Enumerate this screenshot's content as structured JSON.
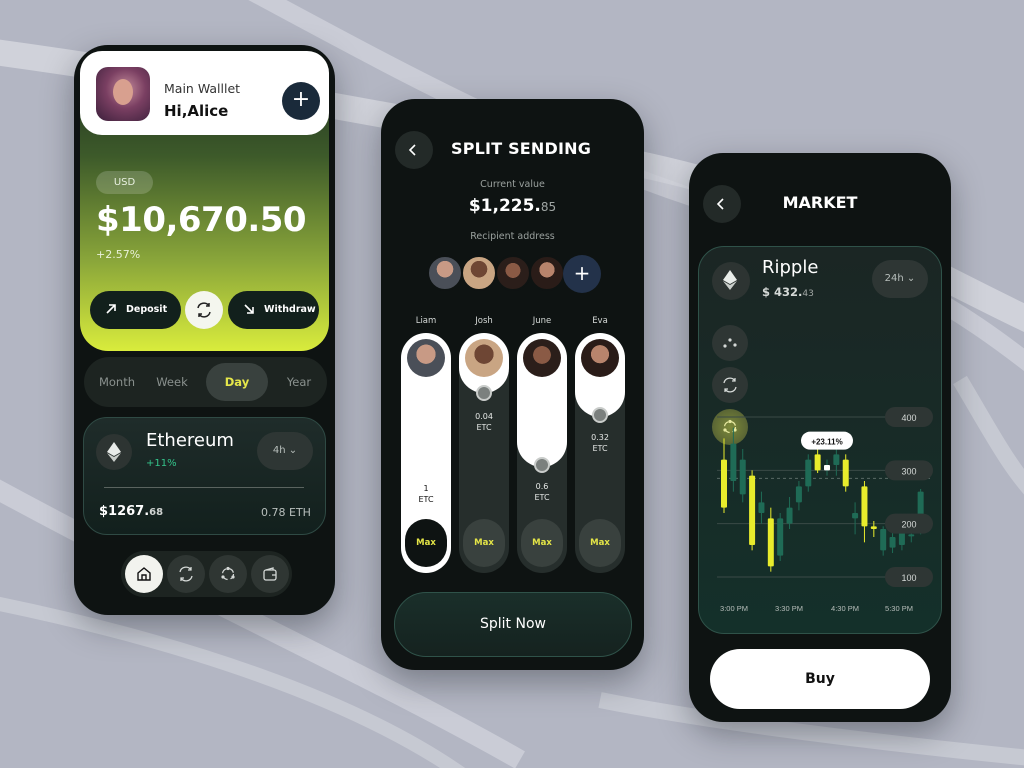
{
  "colors": {
    "background": "#b3b6c3",
    "phone": "#0e1312",
    "accent_yellow": "#e4e547",
    "positive_green": "#34c38a",
    "candle_up": "#e8ec2c",
    "candle_down": "#1f6b56"
  },
  "wallet": {
    "subtitle": "Main Walllet",
    "greeting": "Hi,Alice",
    "add_icon": "+",
    "currency": "USD",
    "balance": "$10,670.50",
    "change": "+2.57%",
    "deposit_label": "Deposit",
    "withdraw_label": "Withdraw",
    "periods": [
      "Month",
      "Week",
      "Day",
      "Year"
    ],
    "active_period": "Day",
    "asset": {
      "name": "Ethereum",
      "change": "+11%",
      "interval": "4h",
      "price_main": "$1267.",
      "price_cents": "68",
      "amount": "0.78 ETH"
    },
    "nav": [
      "home-icon",
      "swap-icon",
      "network-icon",
      "wallet-icon"
    ]
  },
  "split": {
    "title": "SPLIT SENDING",
    "current_label": "Current value",
    "current_main": "$1,225.",
    "current_cents": "85",
    "recipient_label": "Recipient address",
    "add_icon": "+",
    "recipients": [
      {
        "name": "Liam",
        "amount": 1,
        "unit": "ETC",
        "fill": 1.0
      },
      {
        "name": "Josh",
        "amount": 0.04,
        "unit": "ETC",
        "fill": 0.26
      },
      {
        "name": "June",
        "amount": 0.6,
        "unit": "ETC",
        "fill": 0.56
      },
      {
        "name": "Eva",
        "amount": 0.32,
        "unit": "ETC",
        "fill": 0.35
      }
    ],
    "max_label": "Max",
    "button_label": "Split Now"
  },
  "market": {
    "title": "MARKET",
    "coin": "Ripple",
    "price_main": "$ 432.",
    "price_cents": "43",
    "interval": "24h",
    "badge": "+23.11%",
    "buy_label": "Buy"
  },
  "chart_data": {
    "type": "candlestick",
    "x_tick_labels": [
      "3:00 PM",
      "3:30 PM",
      "4:30 PM",
      "5:30 PM"
    ],
    "y_tick_labels": [
      "400",
      "300",
      "200",
      "100"
    ],
    "ylim": [
      100,
      400
    ],
    "annotation": "+23.11%",
    "candles": [
      {
        "o": 320,
        "c": 230,
        "h": 360,
        "l": 220,
        "up": true
      },
      {
        "o": 350,
        "c": 280,
        "h": 380,
        "l": 260,
        "up": false
      },
      {
        "o": 255,
        "c": 320,
        "h": 340,
        "l": 240,
        "up": false
      },
      {
        "o": 290,
        "c": 160,
        "h": 300,
        "l": 150,
        "up": true
      },
      {
        "o": 240,
        "c": 220,
        "h": 260,
        "l": 200,
        "up": false
      },
      {
        "o": 210,
        "c": 120,
        "h": 230,
        "l": 110,
        "up": true
      },
      {
        "o": 140,
        "c": 210,
        "h": 220,
        "l": 130,
        "up": false
      },
      {
        "o": 200,
        "c": 230,
        "h": 250,
        "l": 190,
        "up": false
      },
      {
        "o": 240,
        "c": 270,
        "h": 280,
        "l": 225,
        "up": false
      },
      {
        "o": 270,
        "c": 320,
        "h": 330,
        "l": 260,
        "up": false
      },
      {
        "o": 330,
        "c": 300,
        "h": 370,
        "l": 295,
        "up": true
      },
      {
        "o": 300,
        "c": 310,
        "h": 320,
        "l": 290,
        "up": false
      },
      {
        "o": 310,
        "c": 330,
        "h": 345,
        "l": 290,
        "up": false
      },
      {
        "o": 320,
        "c": 270,
        "h": 330,
        "l": 260,
        "up": true
      },
      {
        "o": 210,
        "c": 220,
        "h": 240,
        "l": 180,
        "up": false
      },
      {
        "o": 270,
        "c": 195,
        "h": 280,
        "l": 165,
        "up": true
      },
      {
        "o": 195,
        "c": 190,
        "h": 205,
        "l": 175,
        "up": true
      },
      {
        "o": 190,
        "c": 150,
        "h": 195,
        "l": 140,
        "up": false
      },
      {
        "o": 155,
        "c": 175,
        "h": 195,
        "l": 145,
        "up": false
      },
      {
        "o": 160,
        "c": 190,
        "h": 205,
        "l": 150,
        "up": false
      },
      {
        "o": 180,
        "c": 180,
        "h": 215,
        "l": 165,
        "up": false
      },
      {
        "o": 190,
        "c": 260,
        "h": 265,
        "l": 180,
        "up": false
      }
    ]
  }
}
